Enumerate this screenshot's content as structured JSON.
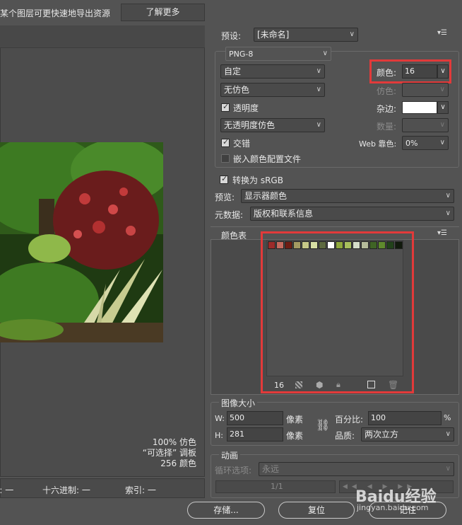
{
  "topbar": {
    "hint": "某个图层可更快速地导出资源",
    "learn_more": "了解更多"
  },
  "preview": {
    "status_quality": "100% 仿色",
    "status_selectable": "“可选择” 调板",
    "status_colors": "256 颜色",
    "footer_alpha": "a: 一",
    "footer_hex": "十六进制: 一",
    "footer_index": "索引: 一"
  },
  "settings": {
    "preset_label": "预设:",
    "preset_value": "[未命名]",
    "format": "PNG-8",
    "reduction": "自定",
    "colors_label": "颜色:",
    "colors_value": "16",
    "dither": "无仿色",
    "dither_label": "仿色:",
    "transparency_label": "透明度",
    "matte_label": "杂边:",
    "transparency_dither": "无透明度仿色",
    "amount_label": "数量:",
    "interlaced_label": "交错",
    "web_snap_label": "Web 靠色:",
    "web_snap_value": "0%",
    "embed_profile_label": "嵌入颜色配置文件",
    "convert_srgb_label": "转换为 sRGB",
    "preview_label": "预览:",
    "preview_value": "显示器颜色",
    "metadata_label": "元数据:",
    "metadata_value": "版权和联系信息"
  },
  "color_table": {
    "title": "颜色表",
    "count": "16",
    "swatches": [
      "#9b2b2a",
      "#c46a5e",
      "#6d1d14",
      "#a39a62",
      "#c6c888",
      "#d7dfa3",
      "#5e6a40",
      "#ffffff",
      "#8fa83c",
      "#a7be5c",
      "#d4dcc8",
      "#b5bb9a",
      "#3f6425",
      "#5f8a2d",
      "#22421a",
      "#111a0c"
    ]
  },
  "image_size": {
    "title": "图像大小",
    "w_label": "W:",
    "w_value": "500",
    "h_label": "H:",
    "h_value": "281",
    "px_label": "像素",
    "percent_label": "百分比:",
    "percent_value": "100",
    "percent_unit": "%",
    "quality_label": "品质:",
    "quality_value": "两次立方"
  },
  "animation": {
    "title": "动画",
    "loop_label": "循环选项:",
    "loop_value": "永远",
    "frame_counter": "1/1"
  },
  "buttons": {
    "save": "存储...",
    "reset": "复位",
    "remember": "记住"
  },
  "watermark": {
    "brand": "Baidu经验",
    "url": "jingyan.baidu.com"
  }
}
